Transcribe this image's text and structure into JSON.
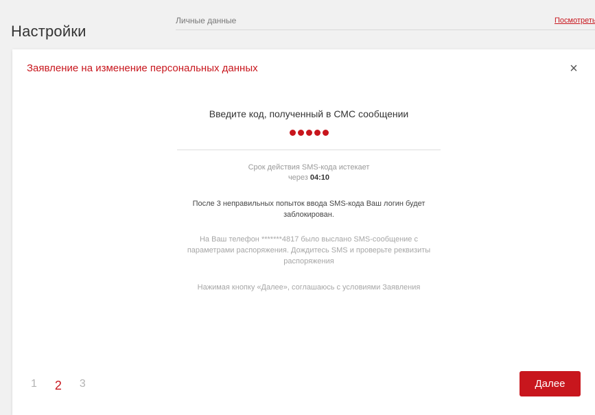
{
  "page": {
    "title": "Настройки"
  },
  "section": {
    "label": "Личные данные",
    "link": "Посмотреть"
  },
  "modal": {
    "title": "Заявление на изменение персональных данных",
    "close_icon": "×",
    "code_prompt": "Введите код, полученный в СМС сообщении",
    "code_mask_length": 5,
    "expiry_text": "Срок действия SMS-кода истекает",
    "expiry_prefix": "через",
    "expiry_timer": "04:10",
    "warning": "После 3 неправильных попыток ввода SMS-кода Ваш логин будет заблокирован.",
    "sms_info": "На Ваш телефон *******4817 было выслано SMS-сообщение с параметрами распоряжения. Дождитесь SMS и проверьте реквизиты распоряжения",
    "consent": "Нажимая кнопку «Далее», соглашаюсь с условиями Заявления",
    "steps": [
      "1",
      "2",
      "3"
    ],
    "active_step": 2,
    "next_label": "Далее"
  },
  "colors": {
    "accent": "#c8161d",
    "background": "#f1f1f1",
    "modal_background": "#ffffff"
  },
  "icons": {
    "close": "close-icon",
    "code_dot": "code-dot-icon"
  }
}
